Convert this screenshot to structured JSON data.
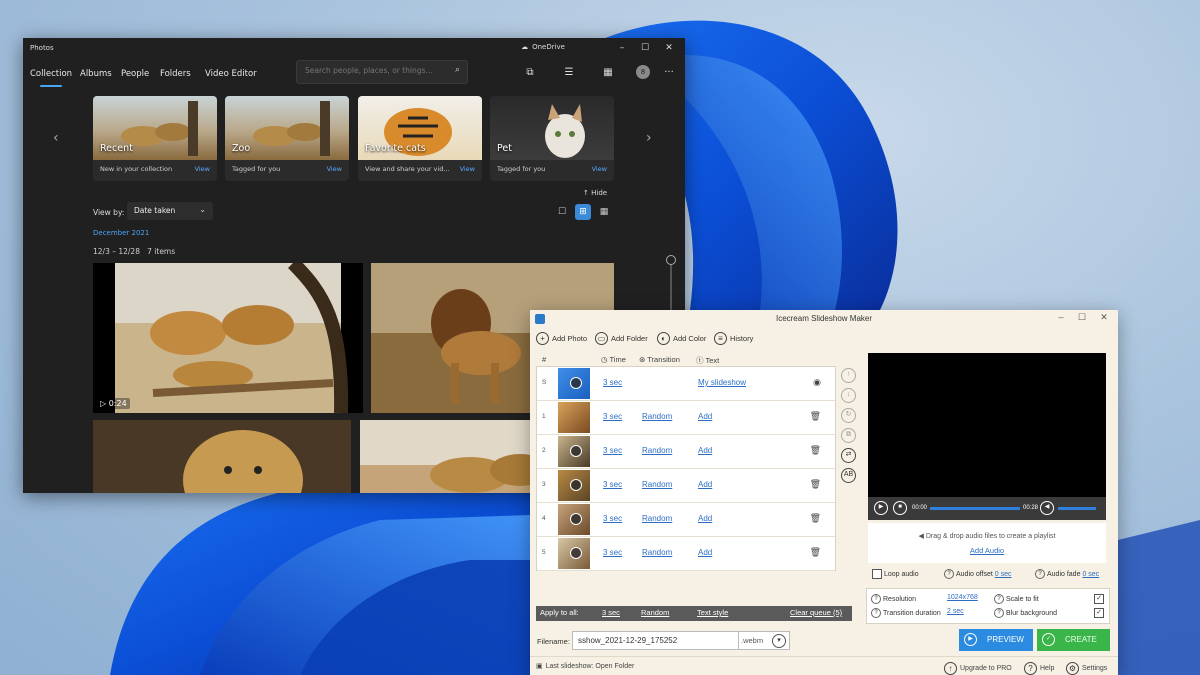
{
  "photos": {
    "app_title": "Photos",
    "onedrive_label": "OneDrive",
    "tabs": [
      "Collection",
      "Albums",
      "People",
      "Folders",
      "Video Editor"
    ],
    "search_placeholder": "Search people, places, or things...",
    "avatar_initial": "8",
    "cards": [
      {
        "title": "Recent",
        "sub": "New in your collection",
        "view": "View"
      },
      {
        "title": "Zoo",
        "sub": "Tagged for you",
        "view": "View"
      },
      {
        "title": "Favorite cats",
        "sub": "View and share your vid...",
        "view": "View"
      },
      {
        "title": "Pet",
        "sub": "Tagged for you",
        "view": "View"
      }
    ],
    "hide_label": "Hide",
    "view_by_label": "View by:",
    "view_by_value": "Date taken",
    "month": "December 2021",
    "date_range": "12/3 – 12/28",
    "item_count": "7 items",
    "video_duration": "0:24"
  },
  "ice": {
    "title": "Icecream Slideshow Maker",
    "toolbar": {
      "add_photo": "Add Photo",
      "add_folder": "Add Folder",
      "add_color": "Add Color",
      "history": "History"
    },
    "headers": {
      "num": "#",
      "time": "Time",
      "transition": "Transition",
      "text": "Text"
    },
    "rows": [
      {
        "num": "S",
        "time": "3 sec",
        "transition": "",
        "text": "My slideshow"
      },
      {
        "num": "1",
        "time": "3 sec",
        "transition": "Random",
        "text": "Add"
      },
      {
        "num": "2",
        "time": "3 sec",
        "transition": "Random",
        "text": "Add"
      },
      {
        "num": "3",
        "time": "3 sec",
        "transition": "Random",
        "text": "Add"
      },
      {
        "num": "4",
        "time": "3 sec",
        "transition": "Random",
        "text": "Add"
      },
      {
        "num": "5",
        "time": "3 sec",
        "transition": "Random",
        "text": "Add"
      }
    ],
    "apply": {
      "label": "Apply to all:",
      "time": "3 sec",
      "transition": "Random",
      "text": "Text style",
      "clear": "Clear queue (5)"
    },
    "player": {
      "time_start": "00:00",
      "time_end": "00:28"
    },
    "audio": {
      "drag": "Drag & drop audio files to create a playlist",
      "add": "Add Audio",
      "loop": "Loop audio",
      "offset_label": "Audio offset",
      "offset_value": "0 sec",
      "fade_label": "Audio fade",
      "fade_value": "0 sec"
    },
    "settings": {
      "resolution_label": "Resolution",
      "resolution_value": "1024x768",
      "transition_label": "Transition duration",
      "transition_value": "2 sec",
      "scale": "Scale to fit",
      "blur": "Blur background"
    },
    "filename_label": "Filename:",
    "filename_value": "sshow_2021-12-29_175252",
    "extension": ".webm",
    "preview": "PREVIEW",
    "create": "CREATE",
    "status": {
      "last": "Last slideshow: Open Folder",
      "upgrade": "Upgrade to PRO",
      "help": "Help",
      "settings": "Settings"
    }
  }
}
